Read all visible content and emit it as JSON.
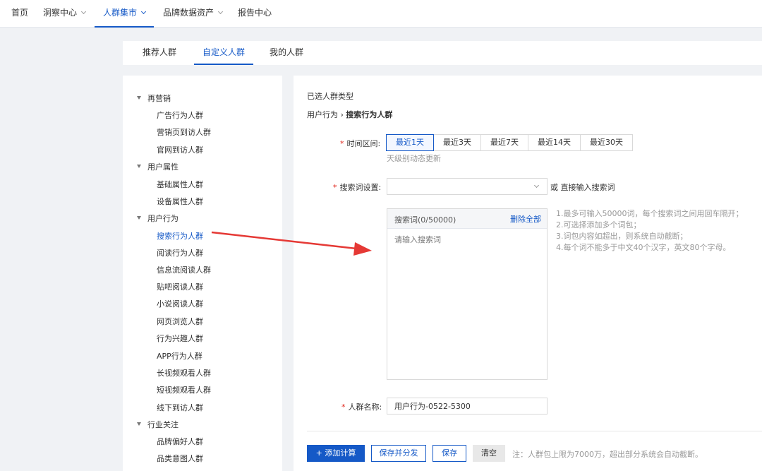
{
  "topnav": {
    "items": [
      {
        "label": "首页",
        "dropdown": false,
        "active": false
      },
      {
        "label": "洞察中心",
        "dropdown": true,
        "active": false
      },
      {
        "label": "人群集市",
        "dropdown": true,
        "active": true
      },
      {
        "label": "品牌数据资产",
        "dropdown": true,
        "active": false
      },
      {
        "label": "报告中心",
        "dropdown": false,
        "active": false
      }
    ]
  },
  "subtabs": [
    {
      "label": "推荐人群",
      "active": false
    },
    {
      "label": "自定义人群",
      "active": true
    },
    {
      "label": "我的人群",
      "active": false
    }
  ],
  "sidebar": {
    "groups": [
      {
        "label": "再营销",
        "items": [
          "广告行为人群",
          "营销页到访人群",
          "官网到访人群"
        ]
      },
      {
        "label": "用户属性",
        "items": [
          "基础属性人群",
          "设备属性人群"
        ]
      },
      {
        "label": "用户行为",
        "items": [
          "搜索行为人群",
          "阅读行为人群",
          "信息流阅读人群",
          "贴吧阅读人群",
          "小说阅读人群",
          "网页浏览人群",
          "行为兴趣人群",
          "APP行为人群",
          "长视频观看人群",
          "短视频观看人群",
          "线下到访人群"
        ]
      },
      {
        "label": "行业关注",
        "items": [
          "品牌偏好人群",
          "品类意图人群"
        ]
      }
    ],
    "active_item": "搜索行为人群"
  },
  "main": {
    "selected_type_title": "已选人群类型",
    "path_prefix": "用户行为 › ",
    "path_current": "搜索行为人群",
    "time_range": {
      "label": "时间区间:",
      "options": [
        "最近1天",
        "最近3天",
        "最近7天",
        "最近14天",
        "最近30天"
      ],
      "selected": "最近1天",
      "hint": "天级别动态更新"
    },
    "keyword_setting": {
      "label": "搜索词设置:",
      "select_value": "",
      "or_text": "或 直接输入搜索词"
    },
    "keyword_box": {
      "count_label": "搜索词(0/50000)",
      "clear_label": "删除全部",
      "placeholder": "请输入搜索词"
    },
    "notes": [
      "1.最多可输入50000词，每个搜索词之间用回车隔开；",
      "2.可选择添加多个词包；",
      "3.词包内容如超出，则系统自动截断；",
      "4.每个词不能多于中文40个汉字，英文80个字母。"
    ],
    "crowd_name": {
      "label": "人群名称:",
      "value": "用户行为-0522-5300"
    },
    "actions": {
      "add_calc": "+ 添加计算",
      "save_distribute": "保存并分发",
      "save": "保存",
      "clear": "清空",
      "footnote": "注：人群包上限为7000万，超出部分系统会自动截断。"
    },
    "required_mark": "*"
  },
  "colors": {
    "accent": "#1559c7",
    "required": "#e1251b",
    "arrow": "#e53935"
  }
}
